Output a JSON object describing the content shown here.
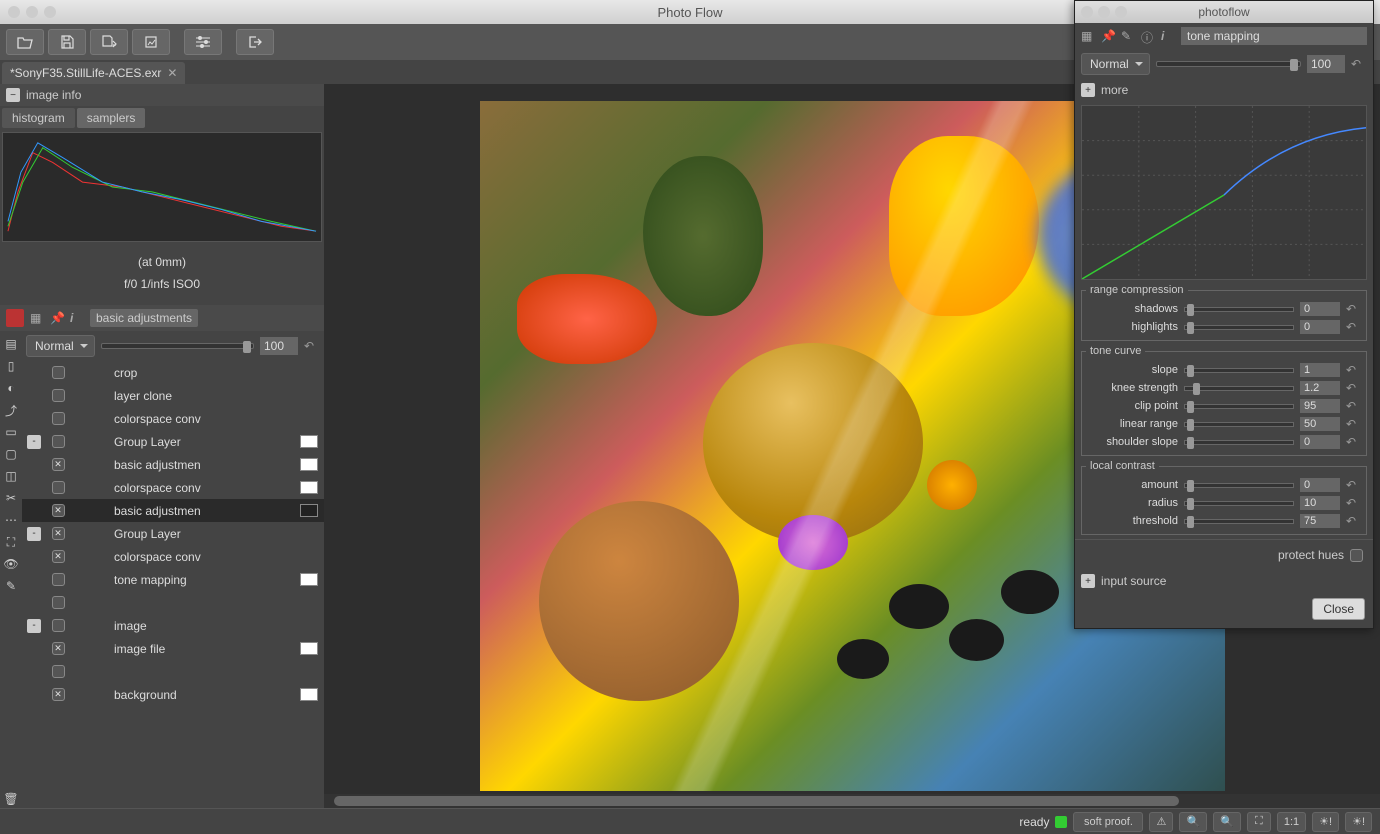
{
  "app": {
    "title": "Photo Flow"
  },
  "document": {
    "filename": "*SonyF35.StillLife-ACES.exr"
  },
  "image_info": {
    "section_label": "image info",
    "tabs": {
      "histogram": "histogram",
      "samplers": "samplers"
    },
    "focal": "(at 0mm)",
    "exposure": "f/0  1/infs  ISO0"
  },
  "layers_panel": {
    "active_name": "basic adjustments",
    "blend_mode": "Normal",
    "opacity": "100",
    "items": [
      {
        "label": "crop",
        "chk": false,
        "swatch": false
      },
      {
        "label": "layer clone",
        "chk": false,
        "swatch": false
      },
      {
        "label": "colorspace conv",
        "chk": false,
        "swatch": false
      },
      {
        "label": "Group Layer",
        "chk": false,
        "swatch": true,
        "exp": "-"
      },
      {
        "label": "basic adjustmen",
        "chk": true,
        "swatch": true
      },
      {
        "label": "colorspace conv",
        "chk": false,
        "swatch": true
      },
      {
        "label": "basic adjustmen",
        "chk": true,
        "swatch": true,
        "selected": true,
        "swatch_dark": true
      },
      {
        "label": "Group Layer",
        "chk": true,
        "swatch": false,
        "exp": "-"
      },
      {
        "label": "colorspace conv",
        "chk": true,
        "swatch": false
      },
      {
        "label": "tone mapping",
        "chk": false,
        "swatch": true
      },
      {
        "label": "",
        "chk": false,
        "swatch": false
      },
      {
        "label": "image",
        "chk": false,
        "swatch": false,
        "exp": "-"
      },
      {
        "label": "image file",
        "chk": true,
        "swatch": true
      },
      {
        "label": "",
        "chk": false,
        "swatch": false
      },
      {
        "label": "background",
        "chk": true,
        "swatch": true
      }
    ]
  },
  "statusbar": {
    "ready": "ready",
    "soft_proof": "soft proof.",
    "one_to_one": "1:1"
  },
  "right_panel": {
    "title": "photoflow",
    "module_name": "tone mapping",
    "blend_mode": "Normal",
    "opacity": "100",
    "more_label": "more",
    "sections": {
      "range_compression": {
        "legend": "range compression",
        "shadows": {
          "label": "shadows",
          "value": "0"
        },
        "highlights": {
          "label": "highlights",
          "value": "0"
        }
      },
      "tone_curve": {
        "legend": "tone curve",
        "slope": {
          "label": "slope",
          "value": "1"
        },
        "knee_strength": {
          "label": "knee strength",
          "value": "1.2"
        },
        "clip_point": {
          "label": "clip point",
          "value": "95"
        },
        "linear_range": {
          "label": "linear range",
          "value": "50"
        },
        "shoulder_slope": {
          "label": "shoulder slope",
          "value": "0"
        }
      },
      "local_contrast": {
        "legend": "local contrast",
        "amount": {
          "label": "amount",
          "value": "0"
        },
        "radius": {
          "label": "radius",
          "value": "10"
        },
        "threshold": {
          "label": "threshold",
          "value": "75"
        }
      }
    },
    "protect_hues": "protect hues",
    "input_source": "input source",
    "close": "Close"
  }
}
